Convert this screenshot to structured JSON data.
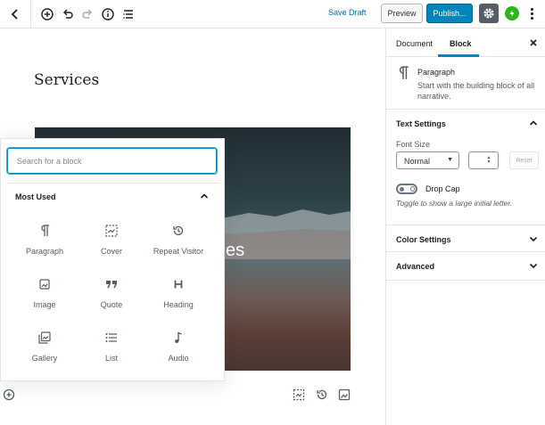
{
  "toolbar": {
    "save_draft": "Save Draft",
    "preview": "Preview",
    "publish": "Publish...",
    "icons": [
      "back-icon",
      "add-block-icon",
      "undo-icon",
      "redo-icon",
      "info-icon",
      "outline-icon",
      "gear-icon",
      "jetpack-icon",
      "more-icon"
    ]
  },
  "editor": {
    "post_title": "Services",
    "cover_text": "es"
  },
  "inserter": {
    "search_placeholder": "Search for a block",
    "section_title": "Most Used",
    "blocks": [
      {
        "label": "Paragraph",
        "icon": "paragraph-icon"
      },
      {
        "label": "Cover",
        "icon": "cover-icon"
      },
      {
        "label": "Repeat Visitor",
        "icon": "repeat-visitor-icon"
      },
      {
        "label": "Image",
        "icon": "image-icon"
      },
      {
        "label": "Quote",
        "icon": "quote-icon"
      },
      {
        "label": "Heading",
        "icon": "heading-icon"
      },
      {
        "label": "Gallery",
        "icon": "gallery-icon"
      },
      {
        "label": "List",
        "icon": "list-icon"
      },
      {
        "label": "Audio",
        "icon": "audio-icon"
      }
    ]
  },
  "sidebar": {
    "tabs": [
      {
        "label": "Document",
        "active": false
      },
      {
        "label": "Block",
        "active": true
      }
    ],
    "block_card": {
      "title": "Paragraph",
      "description": "Start with the building block of all narrative."
    },
    "text_settings": {
      "title": "Text Settings",
      "font_size_label": "Font Size",
      "font_size_value": "Normal",
      "reset_label": "Reset",
      "drop_cap_label": "Drop Cap",
      "drop_cap_help": "Toggle to show a large initial letter."
    },
    "color_settings": {
      "title": "Color Settings"
    },
    "advanced": {
      "title": "Advanced"
    }
  },
  "colors": {
    "accent": "#0085ba",
    "link": "#0073aa",
    "jetpack": "#2fb41f"
  }
}
